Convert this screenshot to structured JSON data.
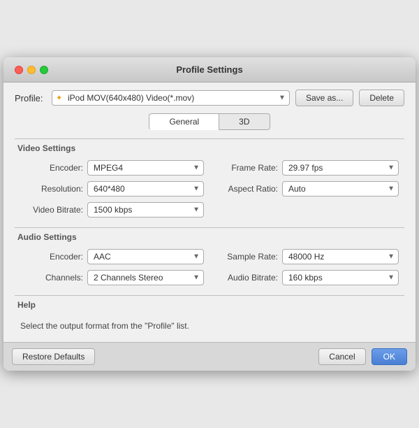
{
  "titleBar": {
    "title": "Profile Settings"
  },
  "profile": {
    "label": "Profile:",
    "value": "iPod MOV(640x480) Video(*.mov)",
    "star": "✦",
    "saveAs": "Save as...",
    "delete": "Delete"
  },
  "tabs": [
    {
      "id": "general",
      "label": "General",
      "active": true
    },
    {
      "id": "3d",
      "label": "3D",
      "active": false
    }
  ],
  "videoSettings": {
    "sectionTitle": "Video Settings",
    "encoder": {
      "label": "Encoder:",
      "value": "MPEG4"
    },
    "resolution": {
      "label": "Resolution:",
      "value": "640*480"
    },
    "videoBitrate": {
      "label": "Video Bitrate:",
      "value": "1500 kbps"
    },
    "frameRate": {
      "label": "Frame Rate:",
      "value": "29.97 fps"
    },
    "aspectRatio": {
      "label": "Aspect Ratio:",
      "value": "Auto"
    }
  },
  "audioSettings": {
    "sectionTitle": "Audio Settings",
    "encoder": {
      "label": "Encoder:",
      "value": "AAC"
    },
    "channels": {
      "label": "Channels:",
      "value": "2 Channels Stereo"
    },
    "sampleRate": {
      "label": "Sample Rate:",
      "value": "48000 Hz"
    },
    "audioBitrate": {
      "label": "Audio Bitrate:",
      "value": "160 kbps"
    }
  },
  "help": {
    "sectionTitle": "Help",
    "text": "Select the output format from the \"Profile\" list."
  },
  "buttons": {
    "restoreDefaults": "Restore Defaults",
    "cancel": "Cancel",
    "ok": "OK"
  }
}
